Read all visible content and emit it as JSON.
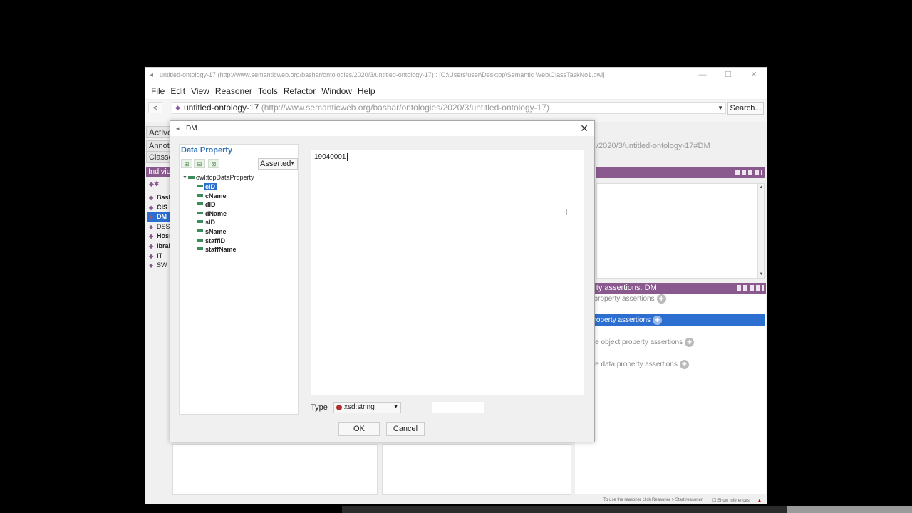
{
  "window": {
    "title": "untitled-ontology-17 (http://www.semanticweb.org/bashar/ontologies/2020/3/untitled-ontology-17) : [C:\\Users\\user\\Desktop\\Semantic Web\\ClassTaskNo1.owl]",
    "minimize": "—",
    "maximize": "☐",
    "close": "✕"
  },
  "menu": [
    "File",
    "Edit",
    "View",
    "Reasoner",
    "Tools",
    "Refactor",
    "Window",
    "Help"
  ],
  "address": {
    "back": "<",
    "back_sub": " ",
    "ontology_name": "untitled-ontology-17",
    "ontology_iri": "(http://www.semanticweb.org/bashar/ontologies/2020/3/untitled-ontology-17)",
    "search": "Search..."
  },
  "background": {
    "tab_active": "Active",
    "tab_annotations": "Annot",
    "tab_classes": "Classe",
    "individuals_header": "Indivic",
    "individuals": [
      {
        "name": "Bash",
        "bold": true
      },
      {
        "name": "CIS",
        "bold": true
      },
      {
        "name": "DM",
        "bold": true,
        "selected": true
      },
      {
        "name": "DSS",
        "bold": false
      },
      {
        "name": "Hoss",
        "bold": true
      },
      {
        "name": "Ibrah",
        "bold": true
      },
      {
        "name": "IT",
        "bold": true
      },
      {
        "name": "SW",
        "bold": false
      }
    ],
    "right_iri": "/2020/3/untitled-ontology-17#DM",
    "assertions_header": "erty assertions: DM",
    "assertions": [
      {
        "label": "t property assertions",
        "selected": false
      },
      {
        "label": "property assertions",
        "selected": true
      },
      {
        "label": "ive object property assertions",
        "selected": false
      },
      {
        "label": "ive data property assertions",
        "selected": false
      }
    ],
    "status_message": "To use the reasoner click Reasoner > Start reasoner",
    "show_inferences": "Show Inferences",
    "accent": "#8a5a8f",
    "selection": "#2d6fd0"
  },
  "dialog": {
    "title": "DM",
    "data_property_header": "Data Property",
    "asserted": "Asserted",
    "tree_root": "owl:topDataProperty",
    "properties": [
      {
        "name": "cID",
        "selected": true
      },
      {
        "name": "cName",
        "selected": false
      },
      {
        "name": "dID",
        "selected": false
      },
      {
        "name": "dName",
        "selected": false
      },
      {
        "name": "sID",
        "selected": false
      },
      {
        "name": "sName",
        "selected": false
      },
      {
        "name": "staffID",
        "selected": false
      },
      {
        "name": "staffName",
        "selected": false
      }
    ],
    "value": "19040001",
    "type_label": "Type",
    "type_value": "xsd:string",
    "ok": "OK",
    "cancel": "Cancel"
  }
}
